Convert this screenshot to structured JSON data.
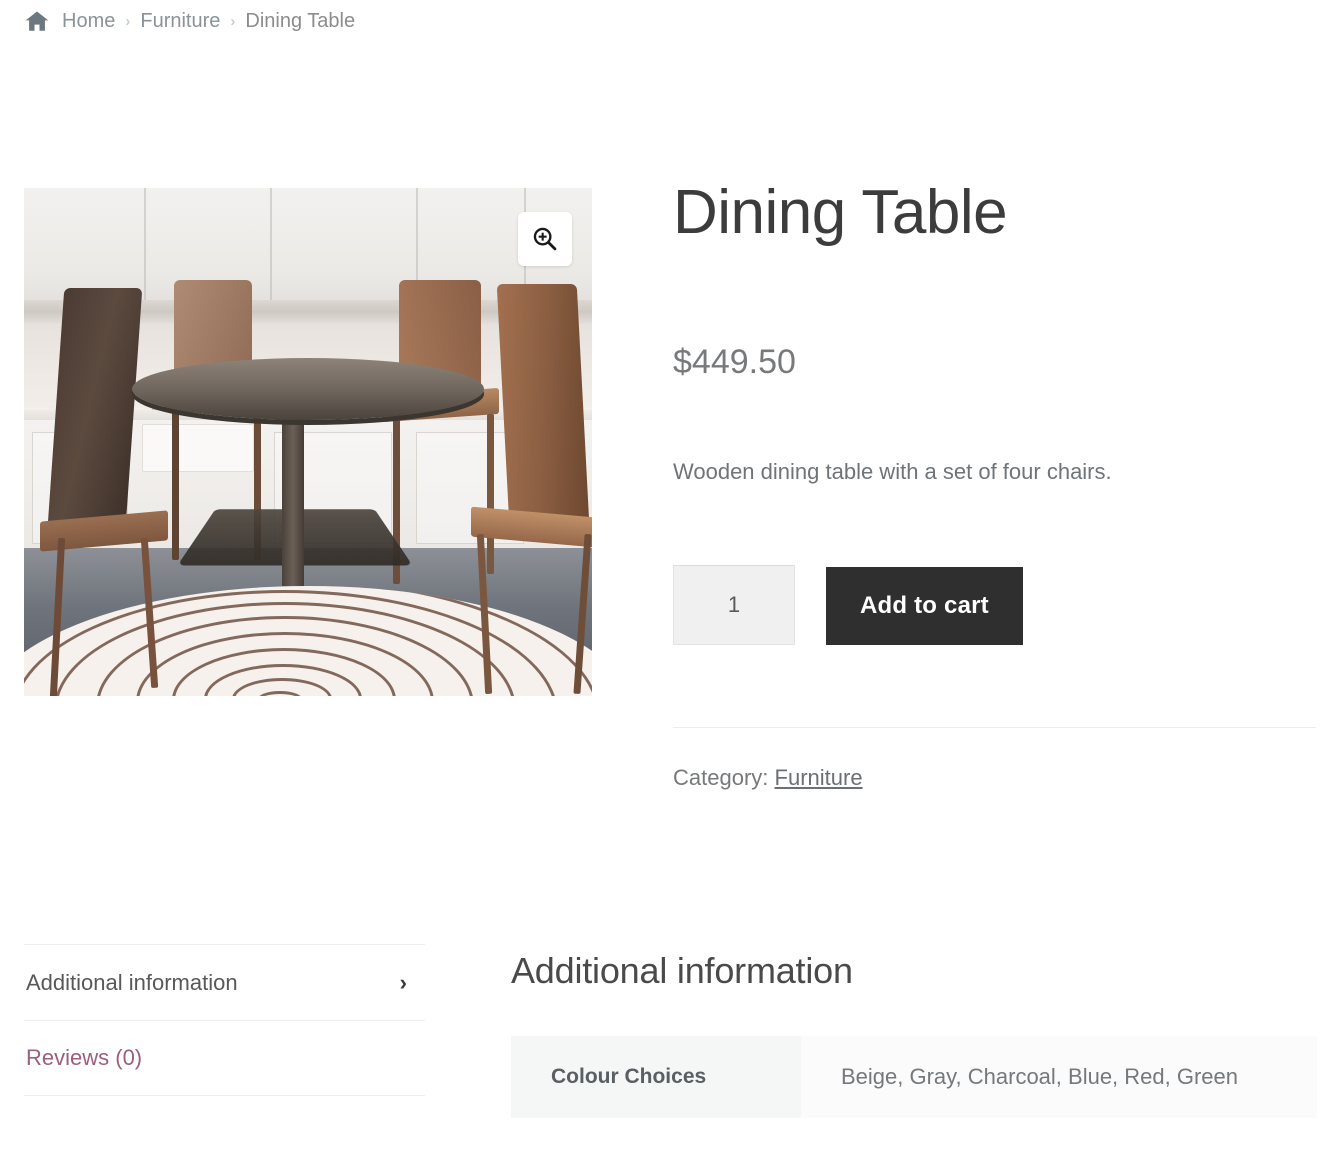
{
  "breadcrumb": {
    "home_icon": "home-icon",
    "separator": "›",
    "items": [
      {
        "label": "Home",
        "type": "link"
      },
      {
        "label": "Furniture",
        "type": "link"
      },
      {
        "label": "Dining Table",
        "type": "current"
      }
    ]
  },
  "gallery": {
    "zoom_icon": "magnifier-plus-icon",
    "image_alt": "Dining Table"
  },
  "product": {
    "title": "Dining Table",
    "price": "$449.50",
    "short_description": "Wooden dining table with a set of four chairs.",
    "quantity_value": "1",
    "quantity_placeholder": "1",
    "add_to_cart_label": "Add to cart",
    "category_label": "Category:",
    "category_value": "Furniture"
  },
  "tabs": {
    "items": [
      {
        "label": "Additional information",
        "active": true,
        "chevron": "›"
      },
      {
        "label": "Reviews (0)",
        "active": false
      }
    ]
  },
  "panel": {
    "title": "Additional information",
    "attributes": [
      {
        "name": "Colour Choices",
        "value": "Beige, Gray, Charcoal, Blue, Red, Green"
      }
    ]
  },
  "colors": {
    "accent_dark": "#2f2f2f",
    "link_purple": "#9b5f7d",
    "text_gray": "#77797b",
    "title_gray": "#3c3c3c",
    "panel_header_bg": "#f5f6f6"
  }
}
